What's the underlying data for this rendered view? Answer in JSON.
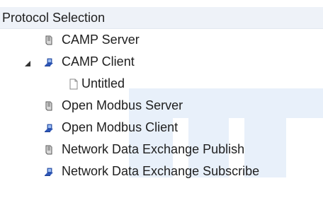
{
  "header": {
    "title": "Protocol Selection"
  },
  "tree": {
    "items": [
      {
        "label": "CAMP Server",
        "icon": "server-icon"
      },
      {
        "label": "CAMP Client",
        "icon": "client-icon",
        "expanded": true
      },
      {
        "label": "Untitled",
        "icon": "document-icon"
      },
      {
        "label": "Open Modbus Server",
        "icon": "server-icon"
      },
      {
        "label": "Open Modbus Client",
        "icon": "client-icon"
      },
      {
        "label": "Network Data Exchange Publish",
        "icon": "server-icon"
      },
      {
        "label": "Network Data Exchange Subscribe",
        "icon": "client-icon"
      }
    ]
  },
  "colors": {
    "header_bg": "#eef2f8",
    "watermark": "#e8f0fa",
    "text": "#202020",
    "client_icon_blue": "#2d56b8"
  }
}
